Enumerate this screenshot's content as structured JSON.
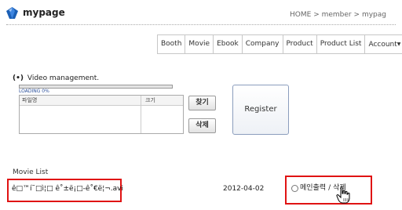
{
  "header": {
    "title": "mypage",
    "breadcrumb": [
      "HOME",
      ">",
      "member",
      ">",
      "mypag"
    ]
  },
  "nav": {
    "items": [
      "Booth",
      "Movie",
      "Ebook",
      "Company",
      "Product",
      "Product List",
      "Account"
    ]
  },
  "video_management": {
    "bullet": "(•)",
    "title": "Video management.",
    "progress_percent": 0,
    "loading_label": "LOADING 0%",
    "table_headers": [
      "파일명",
      "크기"
    ],
    "find_button": "찾기",
    "delete_button": "삭제",
    "register_button": "Register"
  },
  "movie_list": {
    "title": "Movie List",
    "rows": [
      {
        "filename": "ê□™í˜□ì¦□ ê˚±ë¡□-ê˚€ë¦¬.avi",
        "date": "2012-04-02",
        "action": "메인출력",
        "separator": "/",
        "delete": "삭제"
      }
    ]
  },
  "colors": {
    "highlight_box": "#e01313",
    "logo_blue": "#1b5fb5"
  },
  "icons": {
    "logo": "gem-icon",
    "cursor": "hand-pointer-icon"
  }
}
